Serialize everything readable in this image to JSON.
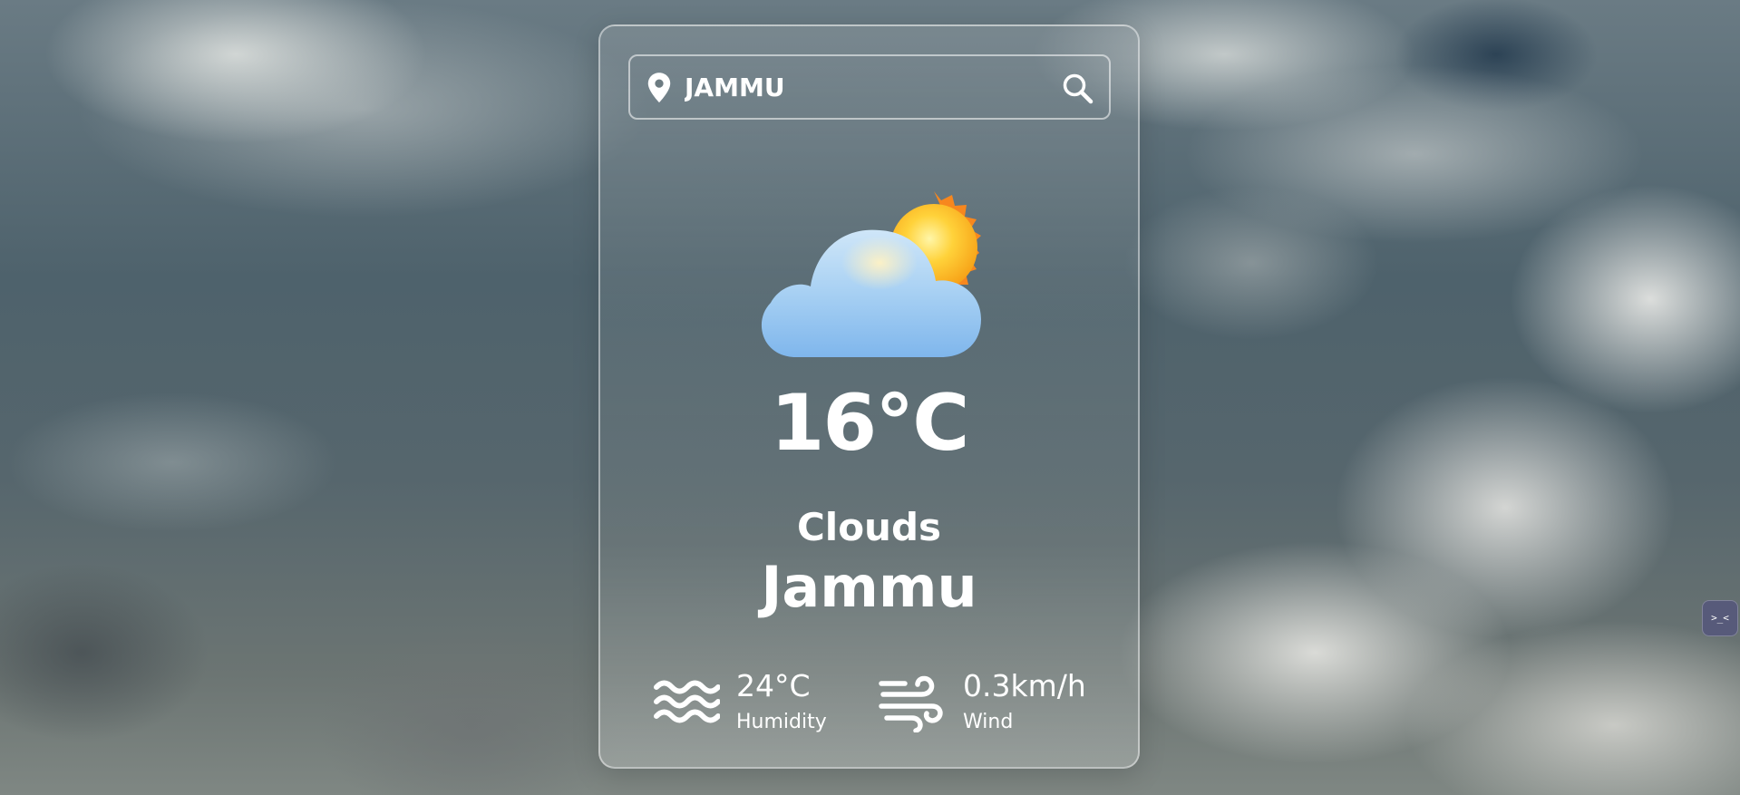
{
  "search": {
    "value": "JAMMU",
    "icon": "location-pin-icon",
    "button_icon": "search-icon"
  },
  "weather": {
    "icon": "partly-cloudy-icon",
    "temperature": "16°C",
    "condition": "Clouds",
    "city": "Jammu"
  },
  "details": {
    "humidity": {
      "value": "24°C",
      "label": "Humidity",
      "icon": "water-waves-icon"
    },
    "wind": {
      "value": "0.3km/h",
      "label": "Wind",
      "icon": "wind-icon"
    }
  },
  "corner_widget": {
    "glyph": ">_<",
    "icon": "assistant-widget-icon"
  },
  "colors": {
    "text": "#ffffff",
    "card_border": "#d9dede",
    "sun": "#f9b12a",
    "cloud": "#9ecbf2",
    "widget": "#575a7a"
  }
}
